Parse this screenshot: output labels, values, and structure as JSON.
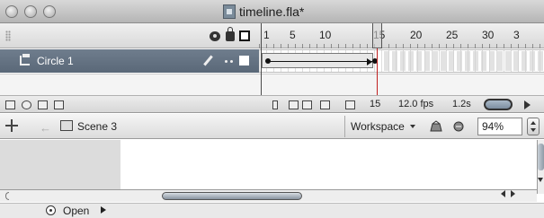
{
  "window": {
    "title": "timeline.fla*"
  },
  "timeline": {
    "ruler_labels": [
      "1",
      "5",
      "10",
      "15",
      "20",
      "25",
      "30",
      "3"
    ],
    "layer": {
      "name": "Circle 1"
    }
  },
  "status": {
    "current_frame": "15",
    "frame_rate": "12.0 fps",
    "elapsed": "1.2s"
  },
  "editbar": {
    "scene": "Scene 3",
    "workspace_label": "Workspace",
    "zoom": "94%"
  },
  "bottom": {
    "open_label": "Open"
  }
}
